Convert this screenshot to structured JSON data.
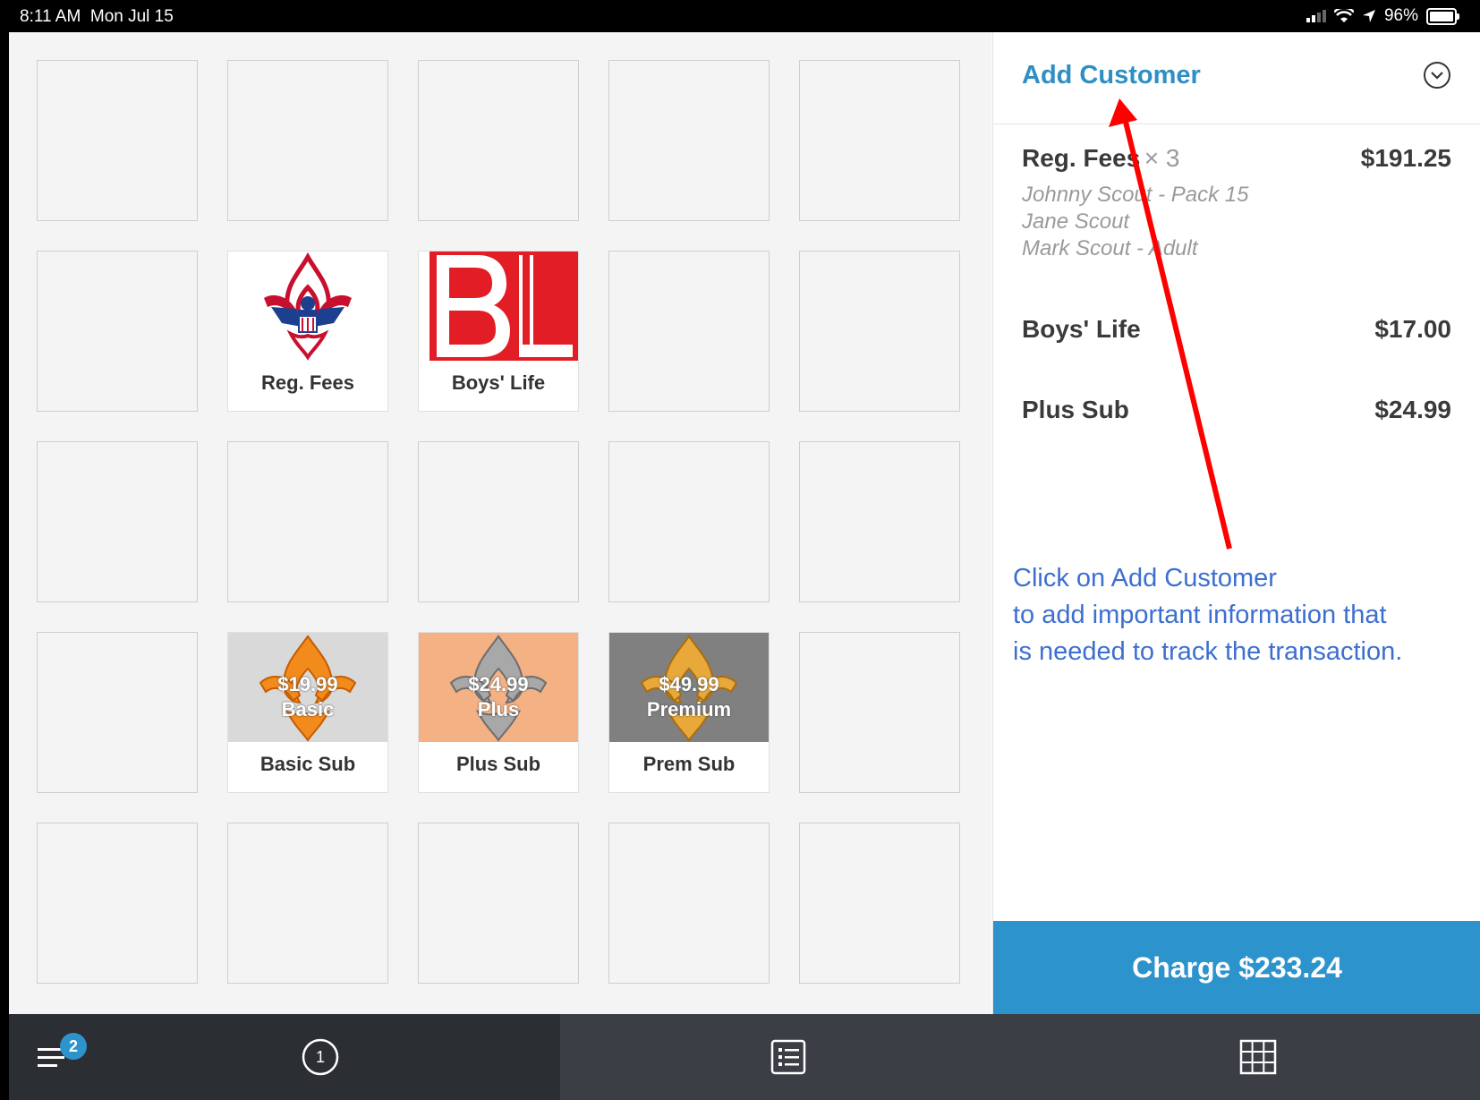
{
  "status_bar": {
    "time": "8:11 AM",
    "date": "Mon Jul 15",
    "battery": "96%"
  },
  "grid": {
    "tiles": [
      {
        "name": "Reg. Fees",
        "image": "bsa-fleur-de-lis-logo"
      },
      {
        "name": "Boys' Life",
        "image": "boys-life-bl-logo"
      },
      {
        "name": "Basic Sub",
        "image": "orange-fleur-de-lis",
        "overlay_price": "$19.99",
        "overlay_label": "Basic",
        "bg": "#d9d9d9"
      },
      {
        "name": "Plus Sub",
        "image": "silver-fleur-de-lis",
        "overlay_price": "$24.99",
        "overlay_label": "Plus",
        "bg": "#f4b184"
      },
      {
        "name": "Prem Sub",
        "image": "gold-fleur-de-lis",
        "overlay_price": "$49.99",
        "overlay_label": "Premium",
        "bg": "#808080"
      }
    ]
  },
  "cart": {
    "add_customer": "Add Customer",
    "items": [
      {
        "label": "Reg. Fees",
        "qty": "× 3",
        "amount": "$191.25",
        "notes": [
          "Johnny Scout - Pack 15",
          "Jane Scout",
          "Mark Scout - Adult"
        ]
      },
      {
        "label": "Boys' Life",
        "amount": "$17.00"
      },
      {
        "label": "Plus Sub",
        "amount": "$24.99"
      }
    ],
    "charge_label": "Charge $233.24"
  },
  "annotation": {
    "lines": [
      "Click on Add Customer",
      "to add important information that",
      "is needed to track the transaction."
    ],
    "color": "#3d6fd0"
  },
  "toolbar": {
    "badge_count": "2",
    "ticket_number": "1"
  },
  "colors": {
    "accent": "#2d93cc",
    "link": "#2f8fc3",
    "arrow": "#ff0000"
  }
}
